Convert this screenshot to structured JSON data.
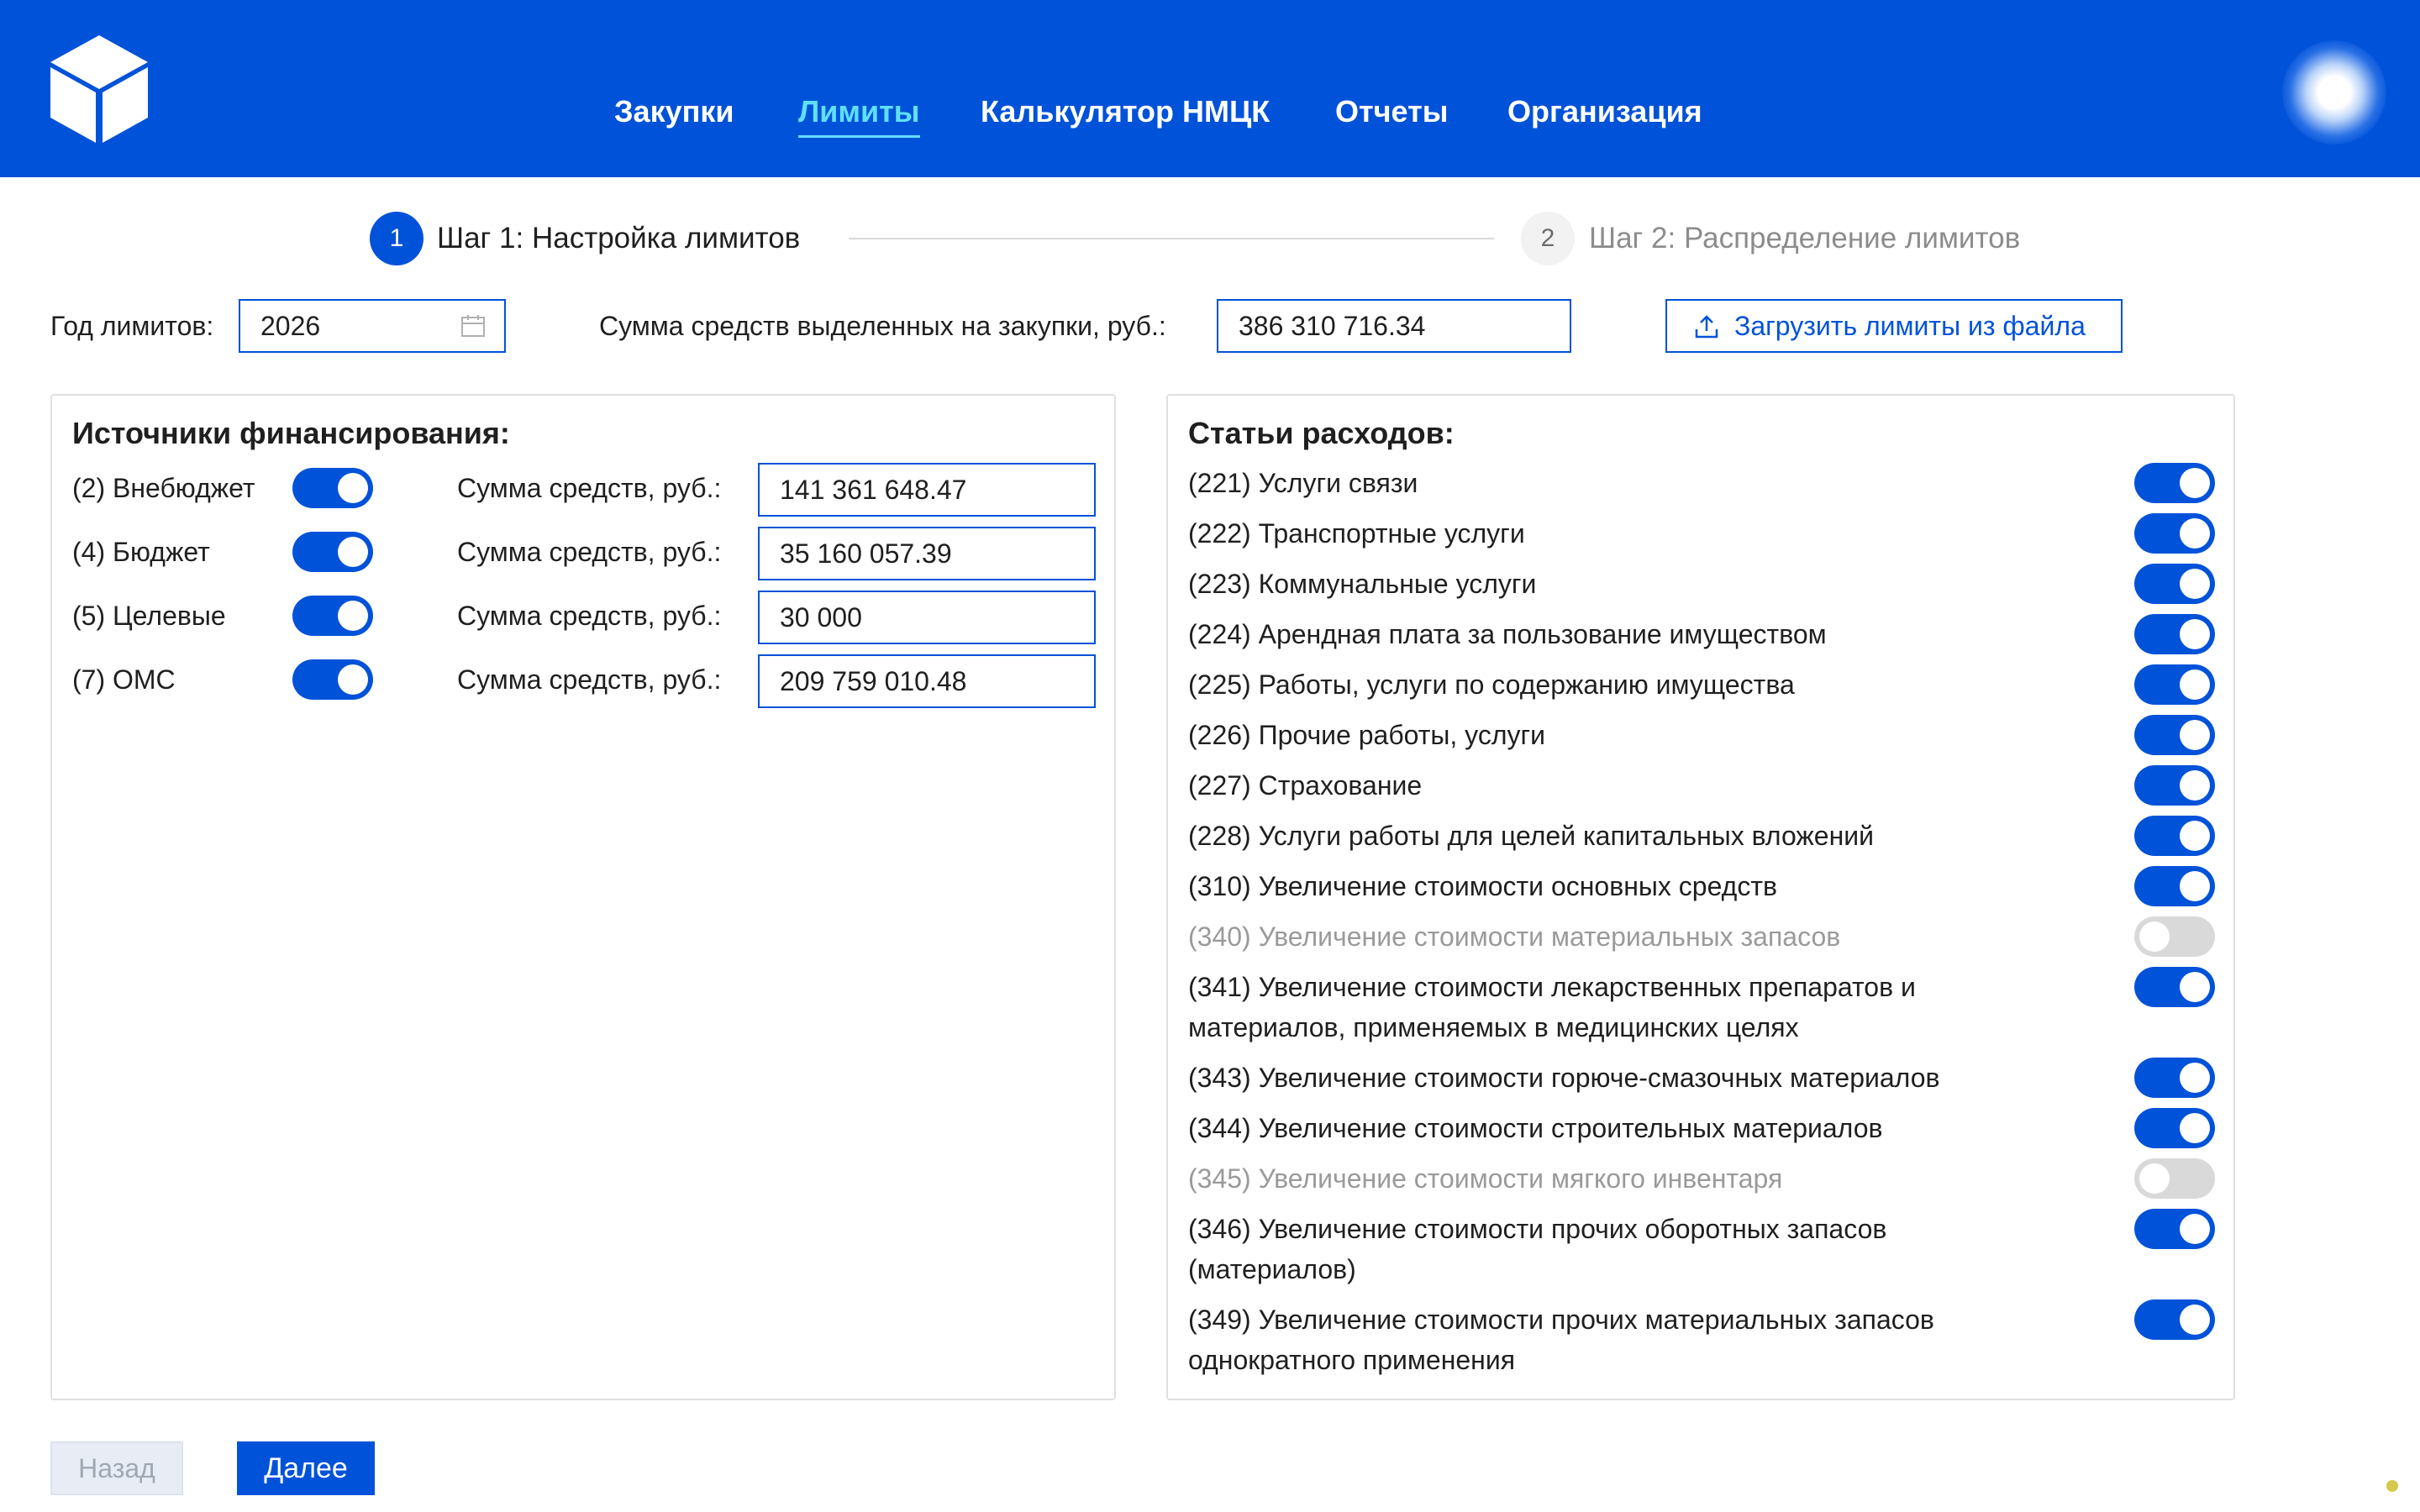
{
  "nav": {
    "items": [
      {
        "label": "Закупки",
        "active": false
      },
      {
        "label": "Лимиты",
        "active": true
      },
      {
        "label": "Калькулятор НМЦК",
        "active": false
      },
      {
        "label": "Отчеты",
        "active": false
      },
      {
        "label": "Организация",
        "active": false
      }
    ],
    "colors": {
      "header_bg": "#0052d9",
      "active_text": "#5fe0ff"
    }
  },
  "stepper": {
    "steps": [
      {
        "number": "1",
        "label": "Шаг 1: Настройка лимитов",
        "state": "active"
      },
      {
        "number": "2",
        "label": "Шаг 2: Распределение лимитов",
        "state": "inactive"
      }
    ]
  },
  "settings": {
    "year_label": "Год лимитов:",
    "year_value": "2026",
    "total_label": "Сумма средств выделенных на закупки, руб.:",
    "total_value": "386 310 716.34",
    "upload_label": "Загрузить лимиты из файла"
  },
  "sources": {
    "title": "Источники финансирования:",
    "amount_label": "Сумма средств, руб.:",
    "items": [
      {
        "label": "(2) Внебюджет",
        "enabled": true,
        "amount": "141 361 648.47"
      },
      {
        "label": "(4) Бюджет",
        "enabled": true,
        "amount": "35 160 057.39"
      },
      {
        "label": "(5) Целевые",
        "enabled": true,
        "amount": "30 000"
      },
      {
        "label": "(7) ОМС",
        "enabled": true,
        "amount": "209 759 010.48"
      }
    ]
  },
  "expenses": {
    "title": "Статьи расходов:",
    "items": [
      {
        "label": "(221) Услуги связи",
        "enabled": true
      },
      {
        "label": "(222) Транспортные услуги",
        "enabled": true
      },
      {
        "label": "(223) Коммунальные услуги",
        "enabled": true
      },
      {
        "label": "(224) Арендная плата за пользование имуществом",
        "enabled": true
      },
      {
        "label": "(225) Работы, услуги по содержанию имущества",
        "enabled": true
      },
      {
        "label": "(226) Прочие работы, услуги",
        "enabled": true
      },
      {
        "label": "(227) Страхование",
        "enabled": true
      },
      {
        "label": "(228) Услуги работы для целей капитальных вложений",
        "enabled": true
      },
      {
        "label": "(310) Увеличение стоимости основных средств",
        "enabled": true
      },
      {
        "label": "(340) Увеличение стоимости материальных запасов",
        "enabled": false
      },
      {
        "label": "(341) Увеличение стоимости лекарственных препаратов и материалов, применяемых в медицинских целях",
        "enabled": true
      },
      {
        "label": "(343) Увеличение стоимости горюче-смазочных материалов",
        "enabled": true
      },
      {
        "label": "(344) Увеличение стоимости строительных материалов",
        "enabled": true
      },
      {
        "label": "(345) Увеличение стоимости мягкого инвентаря",
        "enabled": false
      },
      {
        "label": "(346) Увеличение стоимости прочих оборотных запасов (материалов)",
        "enabled": true
      },
      {
        "label": "(349) Увеличение стоимости прочих материальных запасов однократного применения",
        "enabled": true
      }
    ]
  },
  "footer": {
    "back_label": "Назад",
    "next_label": "Далее"
  }
}
